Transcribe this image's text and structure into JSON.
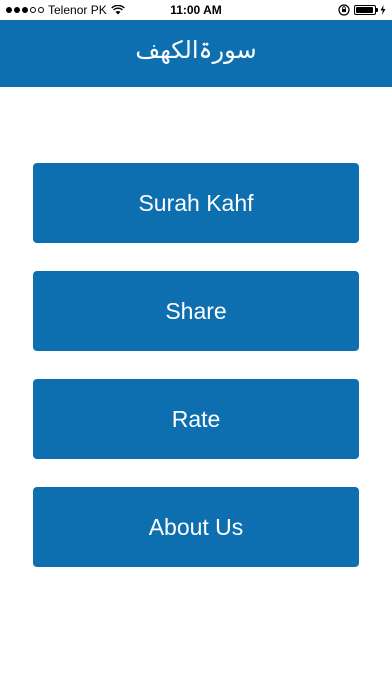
{
  "status_bar": {
    "carrier": "Telenor PK",
    "time": "11:00 AM"
  },
  "nav": {
    "title": "سورۃالکھف"
  },
  "menu": {
    "items": [
      {
        "label": "Surah Kahf"
      },
      {
        "label": "Share"
      },
      {
        "label": "Rate"
      },
      {
        "label": "About Us"
      }
    ]
  },
  "colors": {
    "primary": "#0d6fb0",
    "background": "#ffffff",
    "text_on_primary": "#ffffff"
  },
  "icons": [
    "signal-icon",
    "wifi-icon",
    "rotation-lock-icon",
    "battery-icon",
    "charging-icon"
  ]
}
